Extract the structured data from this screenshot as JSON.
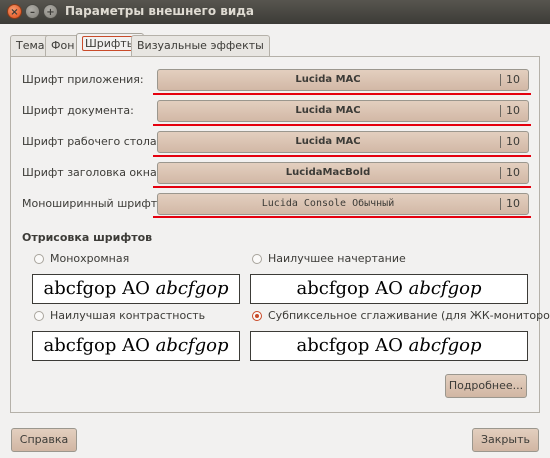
{
  "window": {
    "title": "Параметры внешнего вида"
  },
  "title_buttons": {
    "close": "×",
    "minimize": "–",
    "maximize": "+"
  },
  "tabs": [
    "Тема",
    "Фон",
    "Шрифты",
    "Визуальные эффекты"
  ],
  "active_tab": "Шрифты",
  "fonts": [
    {
      "label": "Шрифт приложения:",
      "font": "Lucida MAC",
      "size": "10"
    },
    {
      "label": "Шрифт документа:",
      "font": "Lucida MAC",
      "size": "10"
    },
    {
      "label": "Шрифт рабочего стола:",
      "font": "Lucida MAC",
      "size": "10"
    },
    {
      "label": "Шрифт заголовка окна:",
      "font": "LucidaMacBold",
      "size": "10"
    },
    {
      "label": "Моноширинный шрифт:",
      "font": "Lucida Console Обычный",
      "size": "10"
    }
  ],
  "rendering": {
    "heading": "Отрисовка шрифтов",
    "options": [
      {
        "label": "Монохромная",
        "selected": false
      },
      {
        "label": "Наилучшее начертание",
        "selected": false
      },
      {
        "label": "Наилучшая контрастность",
        "selected": false
      },
      {
        "label": "Субпиксельное сглаживание (для ЖК-мониторов)",
        "selected": true
      }
    ],
    "preview_plain": "abcfgop AO ",
    "preview_italic": "abcfgop"
  },
  "buttons": {
    "details": "Подробнее...",
    "help": "Справка",
    "close": "Закрыть"
  },
  "colors": {
    "highlight_underline": "#e5000e",
    "accent": "#c94b2a",
    "titlebar": "#3c3b37"
  }
}
